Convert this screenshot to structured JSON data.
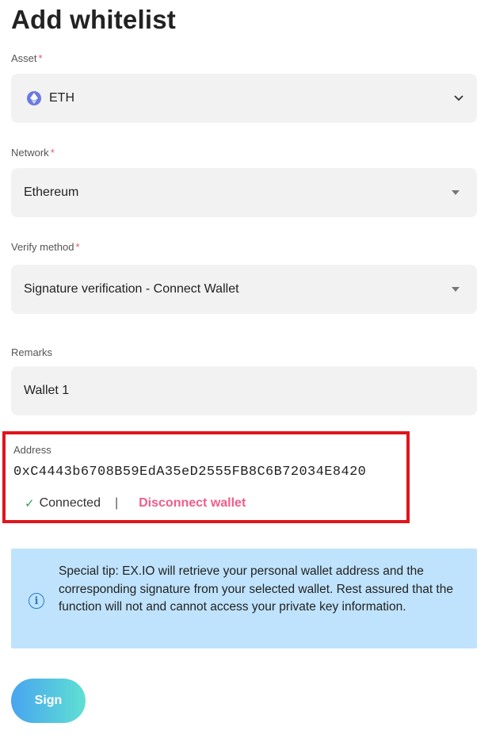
{
  "page": {
    "title": "Add whitelist"
  },
  "asset": {
    "label": "Asset",
    "required_mark": "*",
    "value": "ETH",
    "icon": "eth-icon"
  },
  "network": {
    "label": "Network",
    "required_mark": "*",
    "value": "Ethereum"
  },
  "verify_method": {
    "label": "Verify method",
    "required_mark": "*",
    "value": "Signature verification - Connect Wallet"
  },
  "remarks": {
    "label": "Remarks",
    "value": "Wallet 1"
  },
  "address": {
    "label": "Address",
    "value": "0xC4443b6708B59EdA35eD2555FB8C6B72034E8420",
    "status_check": "✓",
    "status": "Connected",
    "divider": "|",
    "disconnect_label": "Disconnect wallet"
  },
  "tip": {
    "icon": "info-icon",
    "text": "Special tip: EX.IO will retrieve your personal wallet address and the corresponding signature from your selected wallet. Rest assured that the function will not and cannot access your private key information."
  },
  "actions": {
    "sign_label": "Sign"
  },
  "colors": {
    "highlight_border": "#e0151c",
    "disconnect": "#f05e8a",
    "tip_bg": "#bfe3fc",
    "sign_gradient_start": "#48a4f0",
    "sign_gradient_end": "#5fe0d2"
  }
}
